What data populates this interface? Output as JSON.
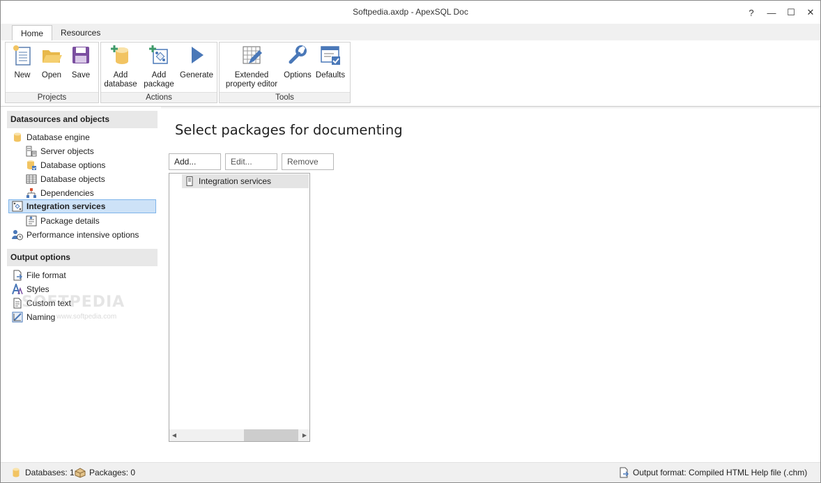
{
  "window": {
    "title": "Softpedia.axdp - ApexSQL Doc",
    "help_glyph": "?",
    "minimize_glyph": "—",
    "maximize_glyph": "☐",
    "close_glyph": "✕"
  },
  "tabs": [
    {
      "label": "Home",
      "active": true
    },
    {
      "label": "Resources",
      "active": false
    }
  ],
  "ribbon": {
    "groups": [
      {
        "label": "Projects",
        "buttons": [
          {
            "label": "New",
            "icon": "new-document-icon"
          },
          {
            "label": "Open",
            "icon": "folder-open-icon"
          },
          {
            "label": "Save",
            "icon": "floppy-disk-icon"
          }
        ]
      },
      {
        "label": "Actions",
        "buttons": [
          {
            "label": "Add\ndatabase",
            "icon": "add-database-icon"
          },
          {
            "label": "Add\npackage",
            "icon": "add-package-icon"
          },
          {
            "label": "Generate",
            "icon": "play-icon"
          }
        ]
      },
      {
        "label": "Tools",
        "buttons": [
          {
            "label": "Extended\nproperty editor",
            "icon": "grid-pencil-icon"
          },
          {
            "label": "Options",
            "icon": "wrench-icon"
          },
          {
            "label": "Defaults",
            "icon": "defaults-window-icon"
          }
        ]
      }
    ]
  },
  "sidebar": {
    "section1": {
      "title": "Datasources and objects",
      "items": [
        {
          "label": "Database engine",
          "icon": "database-icon"
        },
        {
          "label": "Server objects",
          "icon": "server-objects-icon"
        },
        {
          "label": "Database options",
          "icon": "database-options-icon"
        },
        {
          "label": "Database objects",
          "icon": "table-icon"
        },
        {
          "label": "Dependencies",
          "icon": "dependencies-icon"
        },
        {
          "label": "Integration services",
          "icon": "integration-services-icon",
          "selected": true
        },
        {
          "label": "Package details",
          "icon": "package-details-icon"
        },
        {
          "label": "Performance intensive options",
          "icon": "performance-icon"
        }
      ]
    },
    "section2": {
      "title": "Output options",
      "items": [
        {
          "label": "File format",
          "icon": "file-format-icon"
        },
        {
          "label": "Styles",
          "icon": "styles-icon"
        },
        {
          "label": "Custom text",
          "icon": "custom-text-icon"
        },
        {
          "label": "Naming",
          "icon": "naming-icon"
        }
      ]
    }
  },
  "main": {
    "title": "Select packages for documenting",
    "buttons": {
      "add": "Add...",
      "edit": "Edit...",
      "remove": "Remove"
    },
    "list": [
      {
        "label": "Integration services",
        "icon": "server-icon"
      }
    ]
  },
  "watermark": {
    "text": "SOFTPEDIA",
    "sub": "www.softpedia.com"
  },
  "statusbar": {
    "databases": "Databases: 1",
    "packages": "Packages: 0",
    "output_format": "Output format: Compiled HTML Help file (.chm)"
  },
  "colors": {
    "accent": "#4a78b8",
    "selection_bg": "#cde2f7",
    "selection_border": "#7eb4ea",
    "db_yellow": "#f2c462"
  }
}
